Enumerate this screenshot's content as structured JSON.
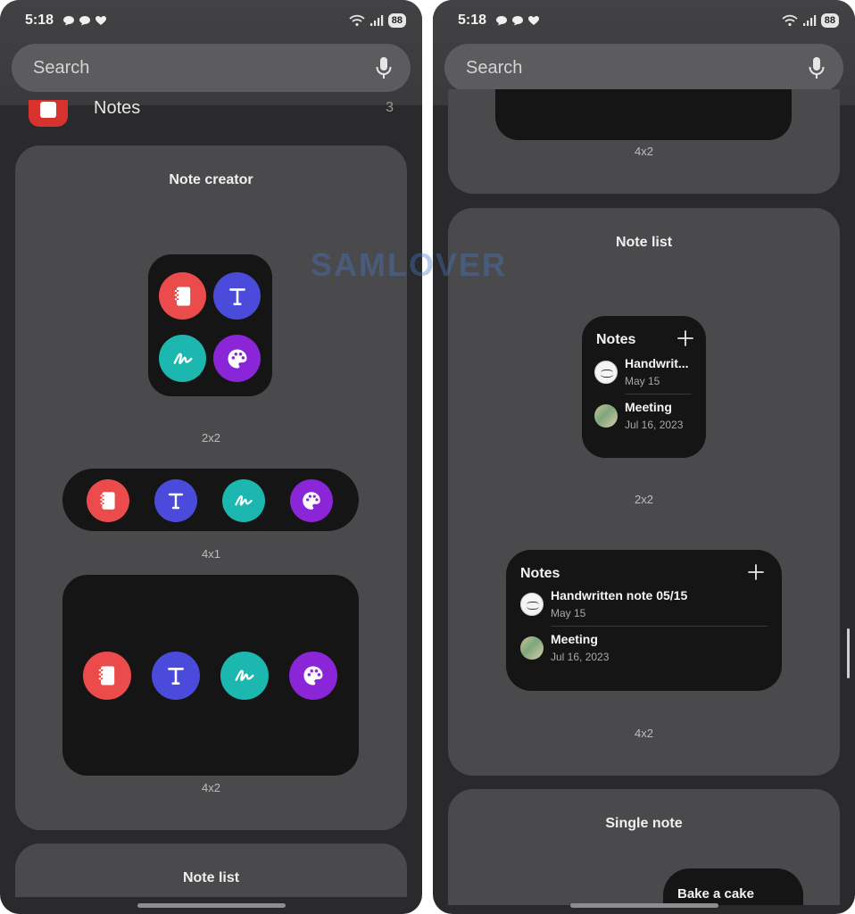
{
  "status": {
    "time": "5:18",
    "battery": "88"
  },
  "search": {
    "placeholder": "Search"
  },
  "app": {
    "name": "Notes",
    "count": "3"
  },
  "left": {
    "note_creator": {
      "title": "Note creator",
      "sizes": [
        "2x2",
        "4x1",
        "4x2"
      ]
    },
    "note_list_title": "Note list"
  },
  "right": {
    "top_card_size": "4x2",
    "note_list": {
      "title": "Note list",
      "widget_header": "Notes",
      "small": {
        "size": "2x2",
        "notes": [
          {
            "title": "Handwrit...",
            "date": "May 15"
          },
          {
            "title": "Meeting",
            "date": "Jul 16, 2023"
          }
        ]
      },
      "large": {
        "size": "4x2",
        "notes": [
          {
            "title": "Handwritten note 05/15",
            "date": "May 15"
          },
          {
            "title": "Meeting",
            "date": "Jul 16, 2023"
          }
        ]
      }
    },
    "single_note": {
      "title": "Single note",
      "note_title": "Bake a cake"
    }
  },
  "icons": [
    "note-icon",
    "text-icon",
    "drawing-icon",
    "palette-icon",
    "plus-icon",
    "mic-icon",
    "wifi-icon",
    "signal-icon",
    "chat-icon",
    "heart-icon"
  ],
  "colors": {
    "red": "#ec4b4b",
    "blue": "#4a4bdb",
    "teal": "#1cb8b0",
    "purple": "#8a25d8",
    "card": "#4a4a4c",
    "background": "#2a2a2c"
  },
  "watermark": "SAMLOVER"
}
